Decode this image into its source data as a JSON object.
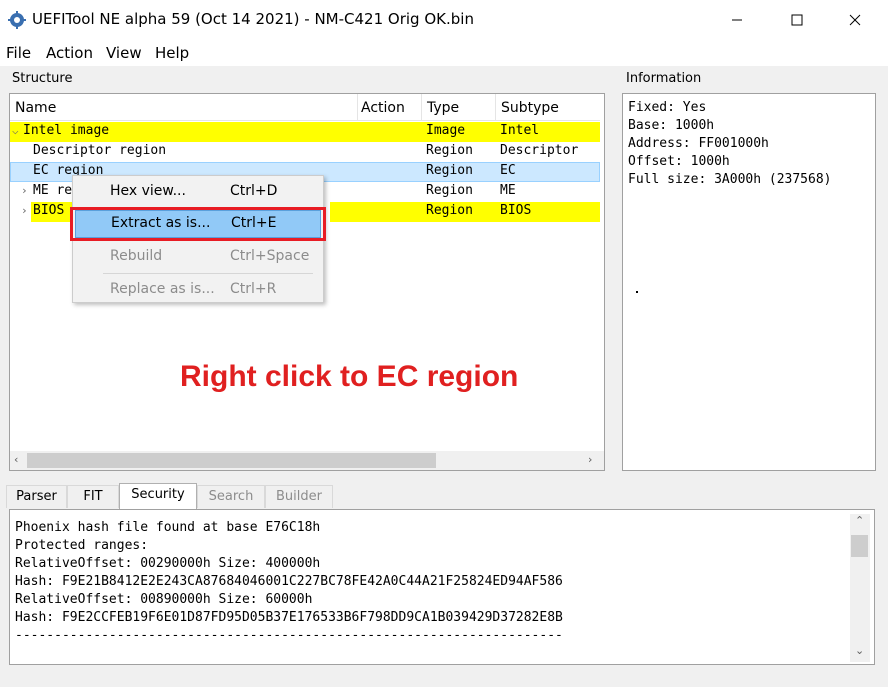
{
  "window": {
    "title": "UEFITool NE alpha 59 (Oct 14 2021) - NM-C421 Orig OK.bin"
  },
  "menu": [
    "File",
    "Action",
    "View",
    "Help"
  ],
  "structure": {
    "label": "Structure",
    "columns": [
      "Name",
      "Action",
      "Type",
      "Subtype"
    ],
    "rows": [
      {
        "name": "Intel image",
        "action": "",
        "type": "Image",
        "subtype": "Intel",
        "expander": "open",
        "highlight": "#ffff00"
      },
      {
        "name": "Descriptor region",
        "action": "",
        "type": "Region",
        "subtype": "Descriptor",
        "expander": "",
        "highlight": ""
      },
      {
        "name": "EC region",
        "action": "",
        "type": "Region",
        "subtype": "EC",
        "expander": "",
        "highlight": "#cce8ff"
      },
      {
        "name": "ME re",
        "action": "",
        "type": "Region",
        "subtype": "ME",
        "expander": "closed",
        "highlight": ""
      },
      {
        "name": "BIOS",
        "action": "",
        "type": "Region",
        "subtype": "BIOS",
        "expander": "closed",
        "highlight": "#ffff00"
      }
    ]
  },
  "context_menu": {
    "items": [
      {
        "label": "Hex view...",
        "shortcut": "Ctrl+D",
        "enabled": true
      },
      {
        "label": "Extract as is...",
        "shortcut": "Ctrl+E",
        "enabled": true,
        "selected": true
      },
      {
        "label": "Rebuild",
        "shortcut": "Ctrl+Space",
        "enabled": false
      },
      {
        "label": "Replace as is...",
        "shortcut": "Ctrl+R",
        "enabled": false
      }
    ]
  },
  "annotation": "Right click to EC region",
  "information": {
    "label": "Information",
    "lines": [
      "Fixed: Yes",
      "Base: 1000h",
      "Address: FF001000h",
      "Offset: 1000h",
      "Full size: 3A000h (237568)"
    ]
  },
  "tabs": [
    {
      "label": "Parser",
      "active": false,
      "enabled": true
    },
    {
      "label": "FIT",
      "active": false,
      "enabled": true
    },
    {
      "label": "Security",
      "active": true,
      "enabled": true
    },
    {
      "label": "Search",
      "active": false,
      "enabled": false
    },
    {
      "label": "Builder",
      "active": false,
      "enabled": false
    }
  ],
  "security_log": [
    "Phoenix hash file found at base E76C18h",
    "Protected ranges:",
    "RelativeOffset: 00290000h Size: 400000h",
    "Hash: F9E21B8412E2E243CA87684046001C227BC78FE42A0C44A21F25824ED94AF586",
    "RelativeOffset: 00890000h Size: 60000h",
    "Hash: F9E2CCFEB19F6E01D87FD95D05B37E176533B6F798DD9CA1B039429D37282E8B",
    "----------------------------------------------------------------------"
  ],
  "colors": {
    "highlight_yellow": "#ffff00",
    "selection_blue": "#cce8ff",
    "menu_selected": "#91c9f7",
    "annotation_red": "#e02020"
  },
  "icons": {
    "app": "uefitool-gear-icon",
    "minimize": "minimize-icon",
    "maximize": "maximize-icon",
    "close": "close-icon"
  }
}
